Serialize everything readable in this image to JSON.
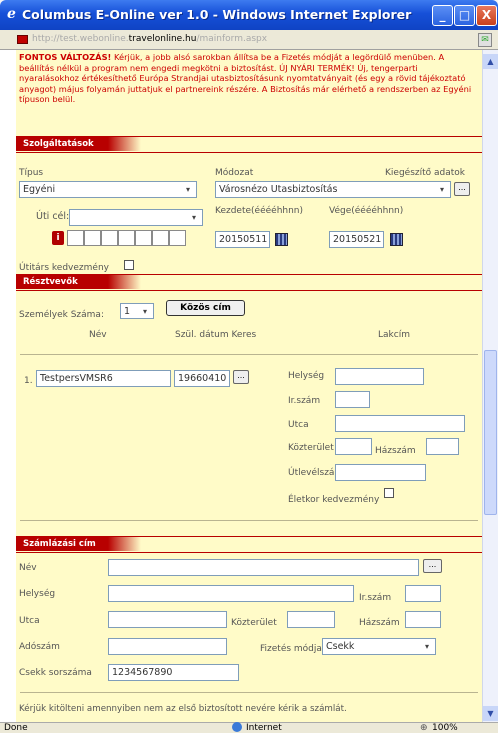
{
  "window": {
    "title": "Columbus E-Online ver 1.0 - Windows Internet Explorer",
    "url_prefix": "http://test.webonline.",
    "url_domain": "travelonline.hu",
    "url_path": "/mainform.aspx",
    "min": "_",
    "max": "□",
    "close": "X"
  },
  "notice": {
    "lead": "FONTOS VÁLTOZÁS!",
    "text": " Kérjük, a jobb alsó sarokban állítsa be a Fizetés módját a legördülő menüben. A beállítás nélkül a program nem engedi megkötni a biztosítást. ÚJ NYÁRI TERMÉK! Új, tengerparti nyaralásokhoz értékesíthető Európa Strandjai utasbiztosításunk nyomtatványait (és egy a rövid tájékoztató anyagot) május folyamán juttatjuk el partnereink részére. A Biztosítás már elérhető a rendszerben az Egyéni típuson belül."
  },
  "services": {
    "header": "Szolgáltatások",
    "tipus_label": "Típus",
    "tipus_value": "Egyéni",
    "modozat_label": "Módozat",
    "modozat_value": "Városnézo Utasbiztosítás",
    "kieg_label": "Kiegészítő adatok",
    "uticel_label": "Úti cél:",
    "uticel_value": "",
    "kezdete_label": "Kezdete(ééééhhnn)",
    "kezdete_value": "20150511",
    "vege_label": "Vége(ééééhhnn)",
    "vege_value": "20150521",
    "utitars_label": "Útitárs kedvezmény",
    "info": "i"
  },
  "participants": {
    "header": "Résztvevők",
    "count_label": "Személyek Száma:",
    "count_value": "1",
    "common_addr": "Közös cím",
    "col_name": "Név",
    "col_birth": "Szül. dátum Keres",
    "col_addr": "Lakcím",
    "row_index": "1.",
    "name_value": "TestpersVMSR6",
    "birth_value": "19660410",
    "helyseg": "Helység",
    "irszam": "Ir.szám",
    "utca": "Utca",
    "kozterulet": "Közterület",
    "hazszam": "Házszám",
    "utlevelszam": "Útlevélszám",
    "eletkor": "Életkor kedvezmény"
  },
  "billing": {
    "header": "Számlázási cím",
    "nev": "Név",
    "helyseg": "Helység",
    "irszam": "Ir.szám",
    "utca": "Utca",
    "kozterulet": "Közterület",
    "hazszam": "Házszám",
    "adoszam": "Adószám",
    "fizetes_label": "Fizetés módja",
    "fizetes_value": "Csekk",
    "csekk_label": "Csekk sorszáma",
    "csekk_value": "1234567890",
    "footer": "Kérjük kitölteni amennyiben nem az első biztosított nevére kérik a számlát."
  },
  "status": {
    "left": "Done",
    "zone": "Internet",
    "zoom": "100%"
  },
  "icons": {
    "ellipsis": "...",
    "dropdown": "▾"
  }
}
